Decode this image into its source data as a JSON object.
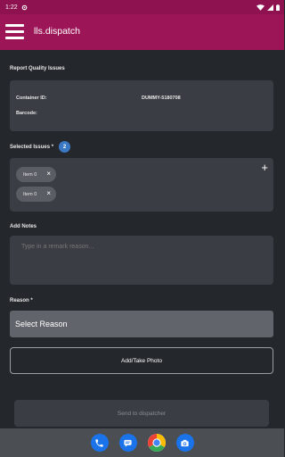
{
  "status_bar": {
    "time": "1:22"
  },
  "app_bar": {
    "title": "lls.dispatch"
  },
  "report": {
    "heading": "Report Quality Issues",
    "container_label": "Container ID:",
    "container_value": "DUMMY-5180708",
    "barcode_label": "Barcode:"
  },
  "issues": {
    "label": "Selected Issues *",
    "count": "2",
    "items": [
      {
        "label": "Item 0"
      },
      {
        "label": "Item 0"
      }
    ]
  },
  "notes": {
    "label": "Add Notes",
    "placeholder": "Type in a remark reason..."
  },
  "reason": {
    "label": "Reason *",
    "selected": "Select Reason"
  },
  "actions": {
    "photo_label": "Add/Take Photo",
    "send_label": "Send to dispatcher"
  },
  "dock": {
    "icons": [
      "phone-icon",
      "messages-icon",
      "chrome-icon",
      "camera-icon"
    ],
    "colors": {
      "phone": "#1a73e8",
      "messages": "#1a73e8",
      "camera": "#1a73e8",
      "accent": "#9c1557"
    }
  }
}
